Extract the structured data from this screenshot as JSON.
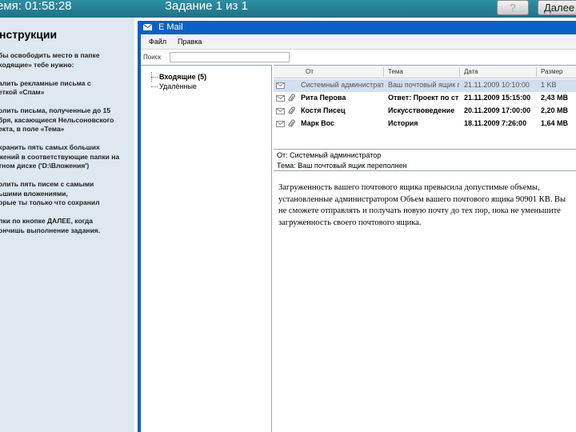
{
  "topbar": {
    "timer": "емя:  01:58:28",
    "task": "Задание 1 из 1",
    "help_label": "?",
    "next_label": "Далее"
  },
  "instructions": {
    "title": "нструкции",
    "body": "бы освободить место в папке\nходящие» тебе нужно:\n\nалить рекламные письма с\nеткой «Спам»\n\nолить письма, полученные до 15\nбря, касающиеся Нельсоновского\nекта, в поле «Тема»\n\nхранить пять самых больших\nжений в соответствующие папки на\nтном диске ('D:\\Вложения')\n\nолить пять писем с самыми\nьшими вложениями,\nорые ты только что сохранил\n\nлки по кнопке ДАЛЕЕ, когда\nончишь выполнение задания."
  },
  "window": {
    "title": "E Mail",
    "menu": [
      "Файл",
      "Правка"
    ],
    "search_label": "Поиск",
    "search_value": ""
  },
  "folders": [
    {
      "label": "Входящие (5)",
      "bold": true
    },
    {
      "label": "Удалённые",
      "bold": false
    }
  ],
  "list": {
    "headers": [
      "От",
      "Тема",
      "Дата",
      "Размер"
    ],
    "rows": [
      {
        "from": "Системный администратор",
        "subject": "Ваш почтовый ящик переполнен",
        "date": "21.11.2009 10:10:00",
        "size": "1 KB",
        "selected": true,
        "bold": false,
        "attachment": false
      },
      {
        "from": "Рита Перова",
        "subject": "Ответ: Проект по стилю",
        "date": "21.11.2009 15:15:00",
        "size": "2,43 МВ",
        "selected": false,
        "bold": true,
        "attachment": true
      },
      {
        "from": "Костя Писец",
        "subject": "Искусствоведение",
        "date": "20.11.2009 17:00:00",
        "size": "2,20 МВ",
        "selected": false,
        "bold": true,
        "attachment": true
      },
      {
        "from": "Марк Вос",
        "subject": "История",
        "date": "18.11.2009 7:26:00",
        "size": "1,64 МВ",
        "selected": false,
        "bold": true,
        "attachment": true
      }
    ]
  },
  "preview": {
    "from_line": "От: Системный администратор",
    "subject_line": "Тема: Ваш почтовый ящик переполнен",
    "body": "Загруженность вашего почтового ящика превысила допустимые объемы, установленные администратором Объем вашего почтового ящика 90901 КВ. Вы не сможете отправлять и получать новую почту до тех пор, пока не уменьшите загруженность своего почтового ящика."
  },
  "colors": {
    "topbar": "#1f7286",
    "window_frame": "#0a5fc8",
    "selected_row": "#d2dff0",
    "instructions_bg": "#dde8f1"
  }
}
